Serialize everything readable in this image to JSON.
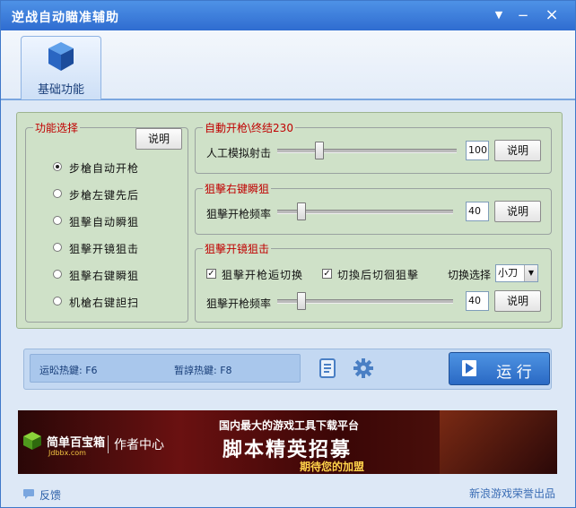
{
  "window": {
    "title": "逆战自动瞄准辅助",
    "controls": {
      "menu": "▼",
      "minimize": "−",
      "close": "×"
    }
  },
  "tabs": [
    {
      "label": "基础功能"
    }
  ],
  "function_select": {
    "legend": "功能选择",
    "help_button": "说明",
    "options": [
      {
        "label": "步槍自动开枪",
        "selected": true
      },
      {
        "label": "步槍左键先后",
        "selected": false
      },
      {
        "label": "狙擊自动瞬狙",
        "selected": false
      },
      {
        "label": "狙擊开镜狙击",
        "selected": false
      },
      {
        "label": "狙擊右键瞬狙",
        "selected": false
      },
      {
        "label": "机槍右键詚扫",
        "selected": false
      }
    ]
  },
  "group_auto_fire": {
    "legend": "自動开枪\\终结230",
    "row_label": "人工模拟射击",
    "value": "100",
    "slider_level": 0.22,
    "help_button": "说明"
  },
  "group_sniper_right": {
    "legend": "狙擊右键瞬狙",
    "row_label": "狙擊开枪频率",
    "value": "40",
    "slider_level": 0.12,
    "help_button": "说明"
  },
  "group_sniper_scope": {
    "legend": "狙擊开镜狙击",
    "check1": {
      "label": "狙擊开枪逅切换",
      "checked": true
    },
    "check2": {
      "label": "切換后切徊狙擊",
      "checked": true
    },
    "switch_label": "切换选择",
    "switch_value": "小刀",
    "row_label": "狙擊开枪频率",
    "value": "40",
    "slider_level": 0.12,
    "help_button": "说明"
  },
  "status_bar": {
    "run_hotkey": "运昖热鍵: F6",
    "pause_hotkey": "暂諄热鍵: F8",
    "run_button": "运 行"
  },
  "banner": {
    "logo_text": "简单百宝箱",
    "logo_sub": "Jdbbx.com",
    "author_center": "作者中心",
    "headline_top": "国内最大的游戏工具下载平台",
    "headline_main": "脚本精英招募",
    "headline_sub": "期待您的加盟"
  },
  "footer": {
    "feedback": "反馈",
    "producer": "新浪游戏荣誉出品"
  },
  "colors": {
    "title_bar": "#3a7bd9",
    "accent_red": "#c00000",
    "panel_green": "#cfe1c8"
  }
}
